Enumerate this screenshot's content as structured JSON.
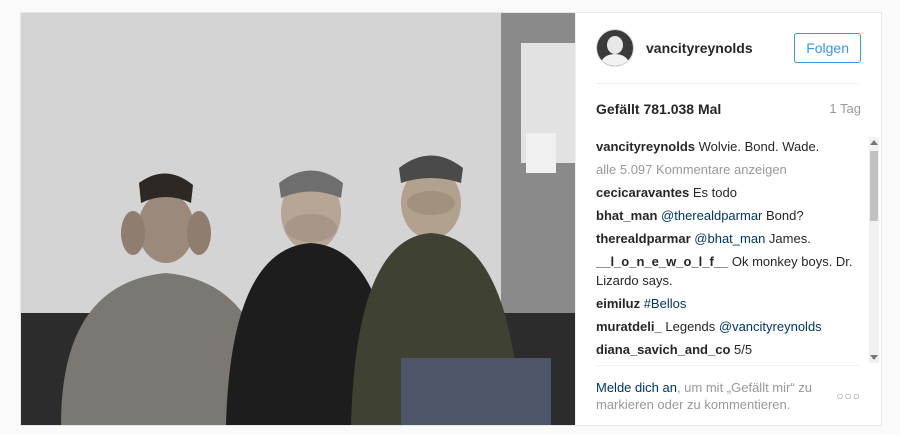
{
  "post": {
    "photo_alt": "",
    "username": "vancityreynolds",
    "follow_label": "Folgen",
    "likes": "Gefällt 781.038 Mal",
    "age": "1 Tag",
    "caption": {
      "user": "vancityreynolds",
      "text": "Wolvie. Bond. Wade."
    },
    "view_all": "alle 5.097 Kommentare anzeigen",
    "comments": [
      {
        "user": "cecicaravantes",
        "parts": [
          {
            "t": "Es todo",
            "m": false
          }
        ]
      },
      {
        "user": "bhat_man",
        "parts": [
          {
            "t": "@therealdparmar",
            "m": true
          },
          {
            "t": " Bond?",
            "m": false
          }
        ]
      },
      {
        "user": "therealdparmar",
        "parts": [
          {
            "t": "@bhat_man",
            "m": true
          },
          {
            "t": " James.",
            "m": false
          }
        ]
      },
      {
        "user": "__l_o_n_e_w_o_l_f__",
        "parts": [
          {
            "t": "Ok monkey boys. Dr. Lizardo says.",
            "m": false
          }
        ]
      },
      {
        "user": "eimiluz",
        "parts": [
          {
            "t": "#Bellos",
            "m": true
          }
        ]
      },
      {
        "user": "muratdeli_",
        "parts": [
          {
            "t": "Legends ",
            "m": false
          },
          {
            "t": "@vancityreynolds",
            "m": true
          }
        ]
      },
      {
        "user": "diana_savich_and_co",
        "parts": [
          {
            "t": "5/5",
            "m": false
          }
        ]
      }
    ],
    "login_link": "Melde dich an",
    "login_rest": ", um mit „Gefällt mir“ zu markieren oder zu kommentieren.",
    "more_icon": "ellipsis-icon"
  }
}
